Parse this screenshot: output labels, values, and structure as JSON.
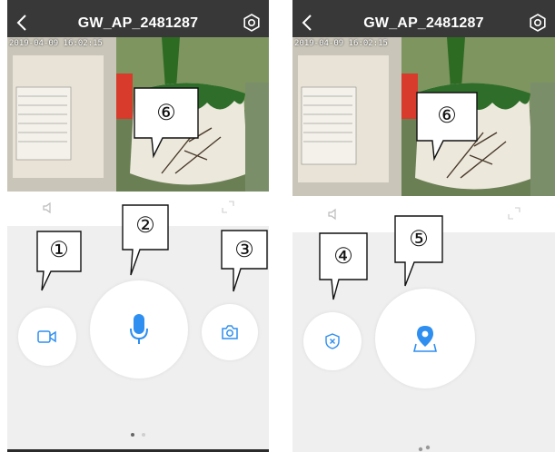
{
  "screens": [
    {
      "title": "GW_AP_2481287",
      "timestamp": "2019-04-09 16:02:15",
      "controls": [
        {
          "name": "record-video-button",
          "icon": "video-camera-icon"
        },
        {
          "name": "talk-button",
          "icon": "microphone-icon"
        },
        {
          "name": "snapshot-button",
          "icon": "camera-icon"
        }
      ],
      "callouts": [
        "①",
        "②",
        "③",
        "⑥"
      ],
      "page_dots": 2
    },
    {
      "title": "GW_AP_2481287",
      "timestamp": "2019-04-09 16:02:15",
      "controls": [
        {
          "name": "disarm-button",
          "icon": "shield-x-icon"
        },
        {
          "name": "location-button",
          "icon": "map-pin-icon"
        }
      ],
      "callouts": [
        "④",
        "⑤",
        "⑥"
      ]
    }
  ],
  "colors": {
    "topbar": "#383838",
    "accent": "#2f8ff0",
    "panel": "#efefef",
    "icon_gray": "#9a9a9a"
  }
}
